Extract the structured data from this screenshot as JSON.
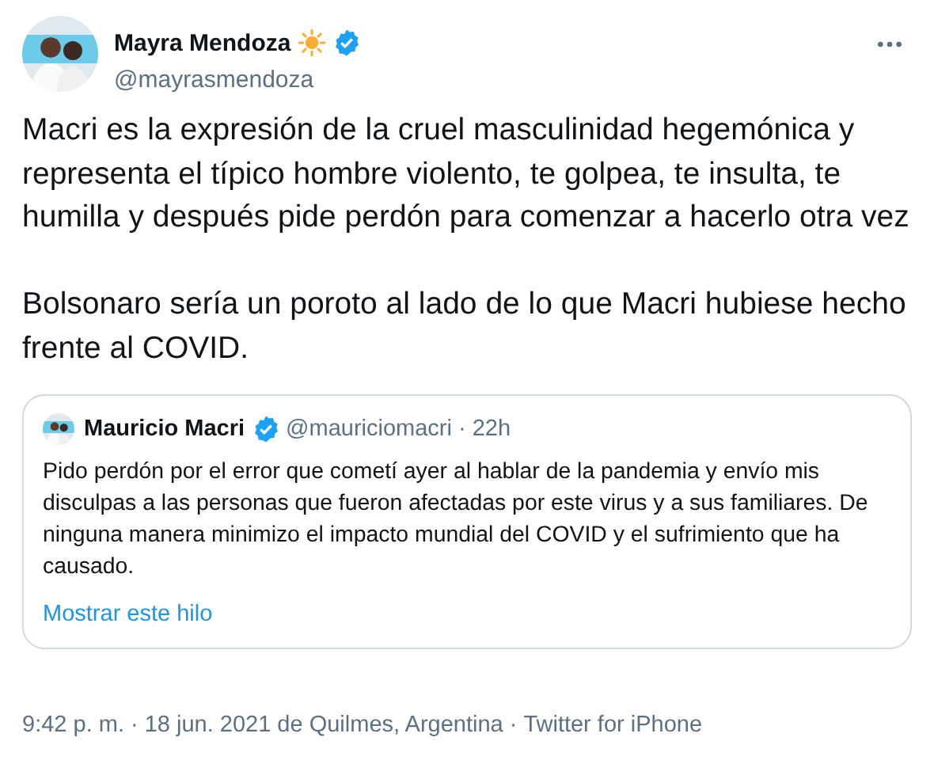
{
  "author": {
    "name": "Mayra Mendoza",
    "handle": "@mayrasmendoza",
    "verified": true
  },
  "paragraphs": [
    "Macri es la expresión de la cruel masculinidad hegemónica y representa el típico hombre violento, te golpea, te insulta, te humilla y después pide perdón para comenzar a hacerlo otra vez",
    "Bolsonaro sería un poroto al lado de lo que Macri hubiese hecho frente al COVID."
  ],
  "quoted": {
    "name": "Mauricio Macri",
    "verified": true,
    "handle": "@mauriciomacri",
    "separator": "·",
    "time": "22h",
    "text": "Pido perdón por el error que cometí ayer al hablar de la pandemia y envío mis disculpas a las personas que fueron afectadas por este virus y a sus familiares. De ninguna manera minimizo el impacto mundial del COVID y el sufrimiento que ha causado.",
    "link": "Mostrar este hilo"
  },
  "footer": {
    "time": "9:42 p. m.",
    "separator1": "·",
    "date": "18 jun. 2021 de Quilmes, Argentina",
    "separator2": "·",
    "source": "Twitter for iPhone"
  }
}
